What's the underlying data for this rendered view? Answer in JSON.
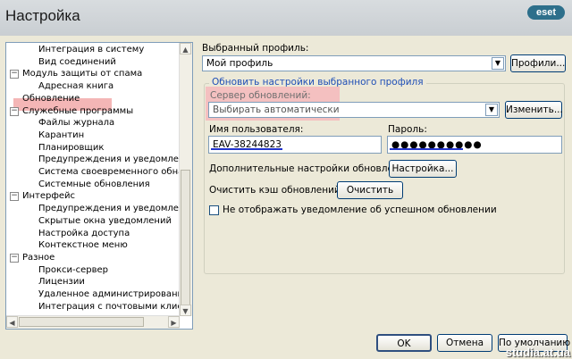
{
  "window": {
    "title": "Настройка",
    "logo": "eset"
  },
  "tree": {
    "items": [
      {
        "label": "Интеграция в систему",
        "level": 2
      },
      {
        "label": "Вид соединений",
        "level": 2
      },
      {
        "label": "Модуль защиты от спама",
        "level": 1,
        "expanded": true
      },
      {
        "label": "Адресная книга",
        "level": 2
      },
      {
        "label": "Обновление",
        "level": 1,
        "selected": true
      },
      {
        "label": "Служебные программы",
        "level": 1,
        "expanded": true
      },
      {
        "label": "Файлы журнала",
        "level": 2
      },
      {
        "label": "Карантин",
        "level": 2
      },
      {
        "label": "Планировщик",
        "level": 2
      },
      {
        "label": "Предупреждения и уведомления",
        "level": 2
      },
      {
        "label": "Система своевременного обнаружен",
        "level": 2
      },
      {
        "label": "Системные обновления",
        "level": 2
      },
      {
        "label": "Интерфейс",
        "level": 1,
        "expanded": true
      },
      {
        "label": "Предупреждения и уведомления",
        "level": 2
      },
      {
        "label": "Скрытые окна уведомлений",
        "level": 2
      },
      {
        "label": "Настройка доступа",
        "level": 2
      },
      {
        "label": "Контекстное меню",
        "level": 2
      },
      {
        "label": "Разное",
        "level": 1,
        "expanded": true
      },
      {
        "label": "Прокси-сервер",
        "level": 2
      },
      {
        "label": "Лицензии",
        "level": 2
      },
      {
        "label": "Удаленное администрирование",
        "level": 2
      },
      {
        "label": "Интеграция с почтовыми клиентами",
        "level": 2
      }
    ]
  },
  "profile": {
    "label": "Выбранный профиль:",
    "value": "Мой профиль",
    "button": "Профили..."
  },
  "update_group": {
    "title": "Обновить настройки выбранного профиля",
    "server_label": "Сервер обновлений:",
    "server_value": "Выбирать автоматически",
    "change_button": "Изменить...",
    "username_label": "Имя пользователя:",
    "username_value": "EAV-38244823",
    "password_label": "Пароль:",
    "password_value": "●●●●●●●●●●",
    "advanced_label": "Дополнительные настройки обновления:",
    "advanced_button": "Настройка...",
    "clear_cache_label": "Очистить кэш обновлений:",
    "clear_button": "Очистить",
    "checkbox_label": "Не отображать уведомление об успешном обновлении",
    "checkbox_checked": false
  },
  "footer": {
    "ok": "OK",
    "cancel": "Отмена",
    "default": "По умолчанию"
  },
  "watermark": "studia.at.ua"
}
